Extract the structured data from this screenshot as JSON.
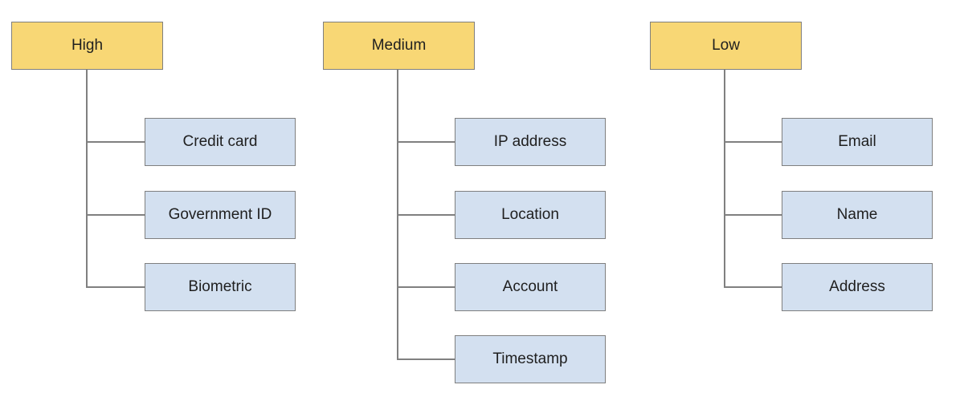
{
  "diagram": {
    "type": "hierarchy",
    "colors": {
      "header_fill": "#f8d775",
      "child_fill": "#d3e0f0",
      "border": "#7f7f7f",
      "connector": "#808080"
    },
    "groups": [
      {
        "label": "High",
        "children": [
          "Credit card",
          "Government ID",
          "Biometric"
        ]
      },
      {
        "label": "Medium",
        "children": [
          "IP address",
          "Location",
          "Account",
          "Timestamp"
        ]
      },
      {
        "label": "Low",
        "children": [
          "Email",
          "Name",
          "Address"
        ]
      }
    ]
  }
}
